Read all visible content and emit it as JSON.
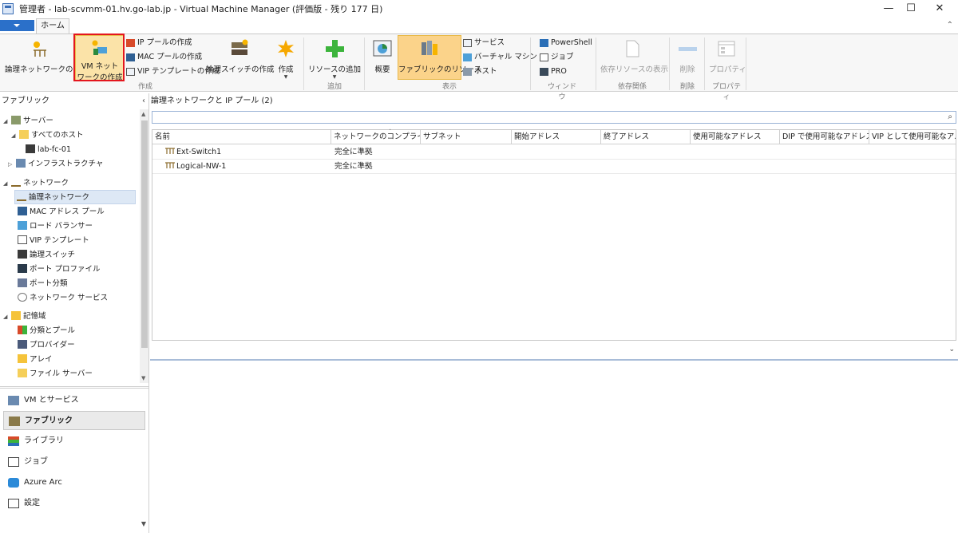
{
  "window": {
    "title": "管理者 - lab-scvmm-01.hv.go-lab.jp - Virtual Machine Manager (評価版 - 残り 177 日)",
    "minimize": "—",
    "maximize": "☐",
    "close": "✕"
  },
  "ribbon": {
    "home_tab": "ホーム",
    "groups": {
      "create": "作成",
      "add": "追加",
      "show": "表示",
      "window": "ウィンドウ",
      "dependencies": "依存関係",
      "delete": "削除",
      "properties": "プロパティ"
    },
    "buttons": {
      "create_logical_network": "論理ネットワークの作成",
      "create_vm_network_line1": "VM ネット",
      "create_vm_network_line2": "ワークの作成",
      "create_ip_pool": "IP プールの作成",
      "create_mac_pool": "MAC プールの作成",
      "create_vip_template": "VIP テンプレートの作成",
      "create_logical_switch": "論理スイッチの作成",
      "create": "作成",
      "add_resources": "リソースの追加",
      "overview": "概要",
      "fabric_resources": "ファブリックのリソース",
      "services": "サービス",
      "virtual_machines": "バーチャル マシン",
      "hosts": "ホスト",
      "powershell": "PowerShell",
      "jobs": "ジョブ",
      "pro": "PRO",
      "view_dependent": "依存リソースの表示",
      "delete": "削除",
      "properties": "プロパティ"
    }
  },
  "nav": {
    "header": "ファブリック",
    "tree": {
      "servers": "サーバー",
      "all_hosts": "すべてのホスト",
      "host1": "lab-fc-01",
      "infrastructure": "インフラストラクチャ",
      "networking": "ネットワーク",
      "logical_networks": "論理ネットワーク",
      "mac_pools": "MAC アドレス プール",
      "load_balancers": "ロード バランサー",
      "vip_templates": "VIP テンプレート",
      "logical_switches": "論理スイッチ",
      "port_profiles": "ポート プロファイル",
      "port_classifications": "ポート分類",
      "network_services": "ネットワーク サービス",
      "storage": "記憶域",
      "classifications_pools": "分類とプール",
      "providers": "プロバイダー",
      "arrays": "アレイ",
      "file_servers": "ファイル サーバー"
    },
    "workspaces": {
      "vms_services": "VM とサービス",
      "fabric": "ファブリック",
      "library": "ライブラリ",
      "jobs": "ジョブ",
      "azure_arc": "Azure Arc",
      "settings": "設定"
    }
  },
  "content": {
    "header": "論理ネットワークと IP プール (2)",
    "search_placeholder": "",
    "columns": {
      "name": "名前",
      "compliance": "ネットワークのコンプライア...",
      "subnet": "サブネット",
      "start_address": "開始アドレス",
      "end_address": "終了アドレス",
      "available_addresses": "使用可能なアドレス",
      "dip_used": "DIP で使用可能なアドレス",
      "vip_used": "VIP として使用可能なア..."
    },
    "rows": [
      {
        "name": "Ext-Switch1",
        "compliance": "完全に準拠"
      },
      {
        "name": "Logical-NW-1",
        "compliance": "完全に準拠"
      }
    ]
  }
}
